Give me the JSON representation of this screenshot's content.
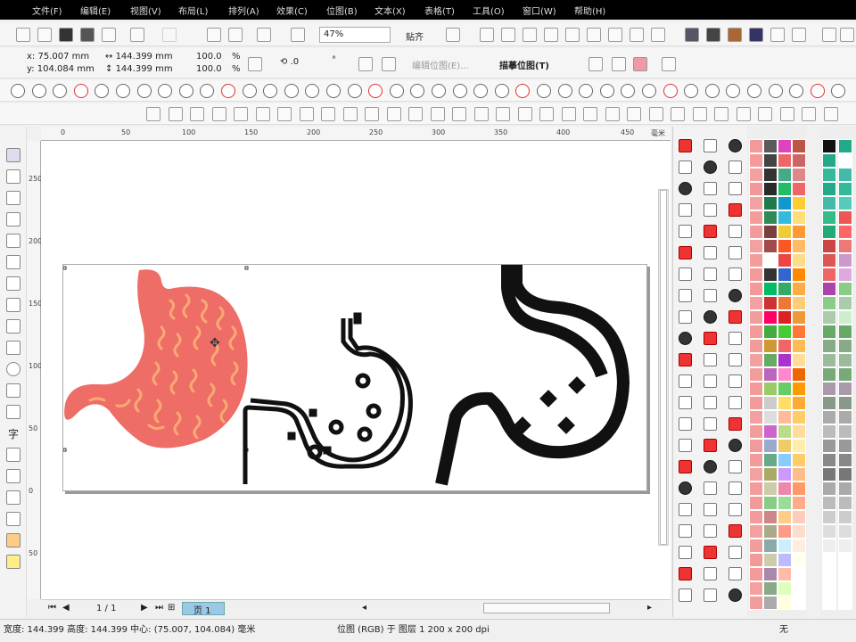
{
  "menubar": {
    "items": [
      "文件(F)",
      "编辑(E)",
      "视图(V)",
      "布局(L)",
      "排列(A)",
      "效果(C)",
      "位图(B)",
      "文本(X)",
      "表格(T)",
      "工具(O)",
      "窗口(W)",
      "帮助(H)"
    ]
  },
  "toolbar": {
    "zoom": "47%",
    "snap_label": "贴齐"
  },
  "property_bar": {
    "x": "x: 75.007 mm",
    "y": "y: 104.084 mm",
    "width": "144.399 mm",
    "height": "144.399 mm",
    "scale_w": "100.0",
    "scale_h": "100.0",
    "percent": "%",
    "rotation": ".0",
    "degree": "°",
    "edit_bitmap": "编辑位图(E)...",
    "trace_bitmap": "描摹位图(T)"
  },
  "ruler_h": {
    "ticks": [
      "0",
      "50",
      "100",
      "150",
      "200",
      "250",
      "300",
      "350",
      "400",
      "450"
    ],
    "unit": "毫米"
  },
  "ruler_v": {
    "ticks": [
      "250",
      "200",
      "150",
      "100",
      "50",
      "0",
      "50"
    ]
  },
  "pagebar": {
    "page_counter": "1 / 1",
    "page_tab": "页 1"
  },
  "statusbar": {
    "dimensions": "宽度: 144.399 高度: 144.399 中心: (75.007, 104.084) 毫米",
    "object_info": "位图 (RGB) 于 图层 1 200 x 200 dpi",
    "fill_label": "无"
  },
  "colors": {
    "stomach_fill": "#ee6d67",
    "stomach_pattern": "#f8a974",
    "icon_stroke": "#111111"
  },
  "icons": [
    "stomach-illustration-icon",
    "stomach-line-icon",
    "stomach-bold-icon"
  ]
}
